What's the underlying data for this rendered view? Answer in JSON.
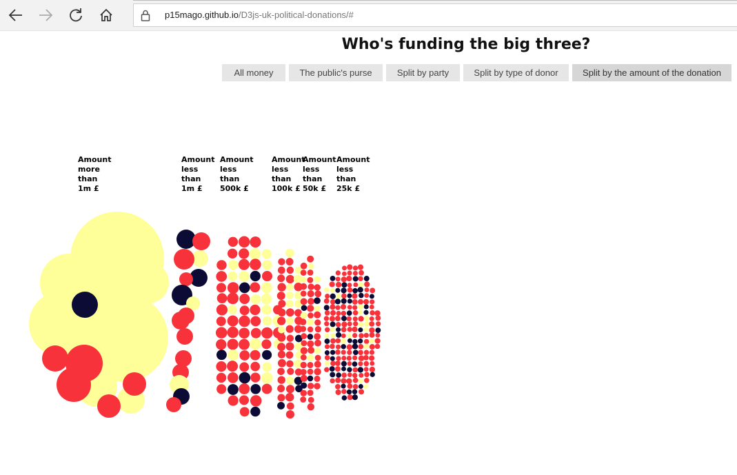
{
  "browser": {
    "url_host": "p15mago.github.io",
    "url_path": "/D3js-uk-political-donations/#"
  },
  "page": {
    "title": "Who's funding the big three?"
  },
  "buttons": [
    {
      "label": "All money"
    },
    {
      "label": "The public's purse"
    },
    {
      "label": "Split by party"
    },
    {
      "label": "Split by type of donor"
    },
    {
      "label": "Split by the amount of the donation",
      "active": true
    }
  ],
  "columns": [
    {
      "label": "Amount\nmore\nthan\n1m £"
    },
    {
      "label": "Amount\nless\nthan\n1m £"
    },
    {
      "label": "Amount\nless\nthan\n500k £"
    },
    {
      "label": "Amount\nless\nthan\n100k £"
    },
    {
      "label": "Amount\nless\nthan\n50k £"
    },
    {
      "label": "Amount\nless\nthan\n25k £"
    }
  ],
  "colors": {
    "party_a": "#ffff99",
    "party_b": "#f8323b",
    "party_c": "#0b0b35",
    "button_bg": "#e6e6e6",
    "button_active_bg": "#d6d6d6"
  },
  "icons": {
    "back": "back-arrow-icon",
    "forward": "forward-arrow-icon",
    "refresh": "refresh-icon",
    "home": "home-icon",
    "lock": "lock-icon"
  }
}
